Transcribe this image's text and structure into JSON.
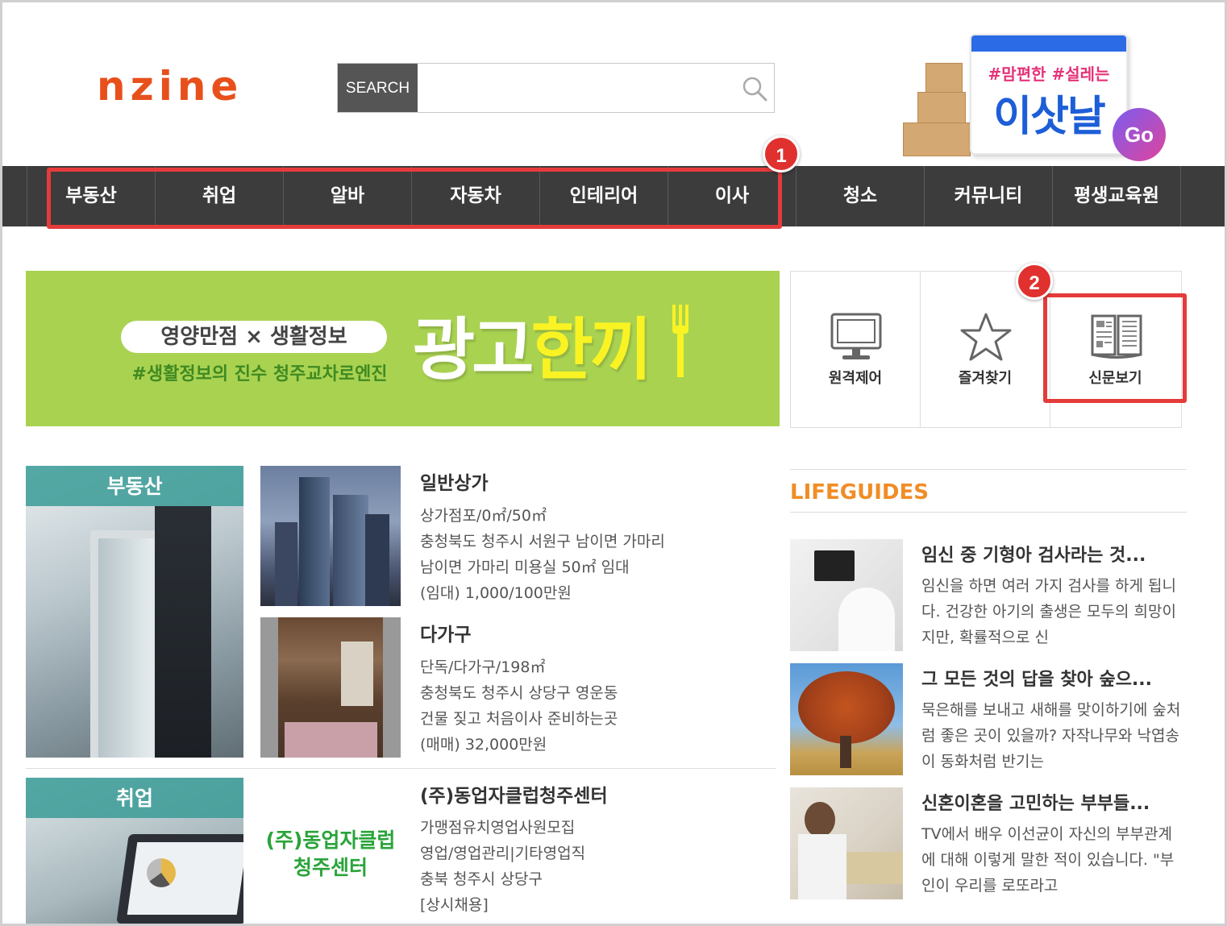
{
  "header": {
    "logo": "nzine",
    "search": {
      "label": "SEARCH",
      "placeholder": ""
    },
    "promo": {
      "tag": "#맘편한 #설레는",
      "title": "이삿날",
      "go": "Go"
    }
  },
  "nav": {
    "items": [
      "부동산",
      "취업",
      "알바",
      "자동차",
      "인테리어",
      "이사",
      "청소",
      "커뮤니티",
      "평생교육원"
    ]
  },
  "annotations": {
    "badge1": "1",
    "badge2": "2"
  },
  "banner": {
    "pill": "영양만점 × 생활정보",
    "sub": "#생활정보의 진수 청주교차로엔진",
    "title_main": "광고",
    "title_accent": "한끼"
  },
  "quick": {
    "items": [
      {
        "label": "원격제어",
        "icon": "monitor-icon"
      },
      {
        "label": "즐겨찾기",
        "icon": "star-icon"
      },
      {
        "label": "신문보기",
        "icon": "newspaper-icon"
      }
    ]
  },
  "listings": [
    {
      "category": "부동산",
      "entries": [
        {
          "title": "일반상가",
          "lines": [
            "상가점포/0㎡/50㎡",
            "충청북도 청주시 서원구 남이면 가마리",
            "남이면 가마리 미용실 50㎡ 임대",
            "(임대) 1,000/100만원"
          ]
        },
        {
          "title": "다가구",
          "lines": [
            "단독/다가구/198㎡",
            "충청북도 청주시 상당구 영운동",
            "건물 짖고 처음이사 준비하는곳",
            "(매매) 32,000만원"
          ]
        }
      ]
    },
    {
      "category": "취업",
      "entries": [
        {
          "title": "(주)동업자클럽청주센터",
          "logo_text_1": "(주)동업자클럽",
          "logo_text_2": "청주센터",
          "lines": [
            "가맹점유치영업사원모집",
            "영업/영업관리|기타영업직",
            "충북 청주시 상당구",
            "[상시채용]"
          ]
        }
      ]
    }
  ],
  "lifeguides": {
    "heading": "LIFEGUIDES",
    "articles": [
      {
        "title": "임신 중 기형아 검사라는 것...",
        "text": "임신을 하면 여러 가지 검사를 하게 됩니다. 건강한 아기의 출생은 모두의 희망이지만, 확률적으로 신"
      },
      {
        "title": "그 모든 것의 답을 찾아 숲으...",
        "text": "묵은해를 보내고 새해를 맞이하기에 숲처럼 좋은 곳이 있을까? 자작나무와 낙엽송이 동화처럼 반기는"
      },
      {
        "title": "신혼이혼을 고민하는 부부들...",
        "text": "TV에서 배우 이선균이 자신의 부부관계에 대해 이렇게 말한 적이 있습니다. \"부인이 우리를 로또라고"
      }
    ]
  },
  "colors": {
    "logo": "#e8501b",
    "nav_bg": "#3c3c3c",
    "highlight": "#e53b3b",
    "banner_bg": "#a9d251",
    "lifeguides_heading": "#f08d26"
  }
}
